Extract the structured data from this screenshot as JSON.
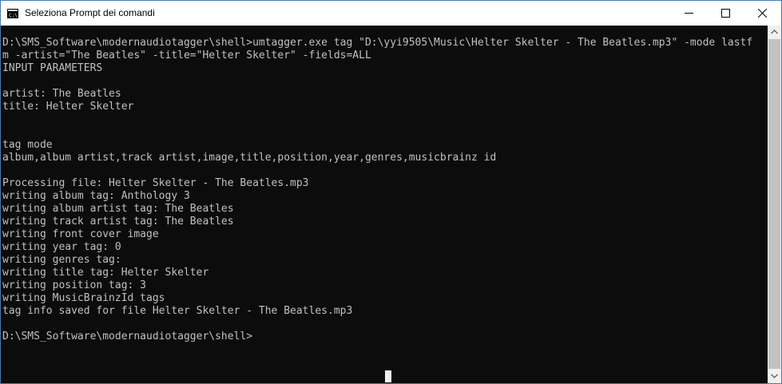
{
  "window": {
    "title": "Seleziona Prompt dei comandi",
    "icon": "cmd-icon",
    "controls": {
      "minimize": "minimize-icon",
      "maximize": "maximize-icon",
      "close": "close-icon"
    }
  },
  "console": {
    "background": "#0c0c0c",
    "foreground": "#c0c0c0",
    "lines": [
      "D:\\SMS_Software\\modernaudiotagger\\shell>umtagger.exe tag \"D:\\yyi9505\\Music\\Helter Skelter - The Beatles.mp3\" -mode lastf",
      "m -artist=\"The Beatles\" -title=\"Helter Skelter\" -fields=ALL",
      "INPUT PARAMETERS",
      "",
      "artist: The Beatles",
      "title: Helter Skelter",
      "",
      "",
      "tag mode",
      "album,album artist,track artist,image,title,position,year,genres,musicbrainz id",
      "",
      "Processing file: Helter Skelter - The Beatles.mp3",
      "writing album tag: Anthology 3",
      "writing album artist tag: The Beatles",
      "writing track artist tag: The Beatles",
      "writing front cover image",
      "writing year tag: 0",
      "writing genres tag:",
      "writing title tag: Helter Skelter",
      "writing position tag: 3",
      "writing MusicBrainzId tags",
      "tag info saved for file Helter Skelter - The Beatles.mp3",
      "",
      "D:\\SMS_Software\\modernaudiotagger\\shell>"
    ]
  }
}
